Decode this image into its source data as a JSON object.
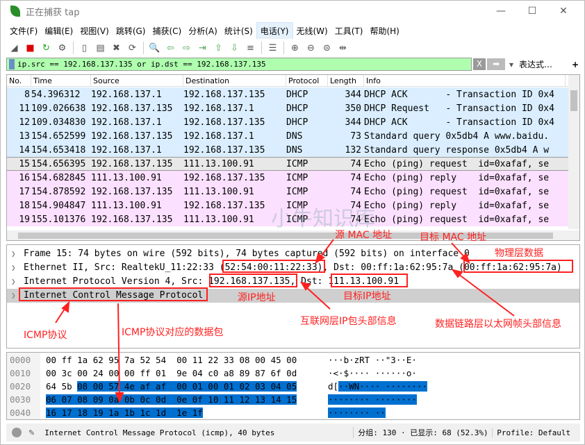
{
  "window": {
    "title": "正在捕获 tap",
    "minimize": "—",
    "maximize": "☐",
    "close": "✕"
  },
  "menu": [
    "文件(F)",
    "编辑(E)",
    "视图(V)",
    "跳转(G)",
    "捕获(C)",
    "分析(A)",
    "统计(S)",
    "电话(Y)",
    "无线(W)",
    "工具(T)",
    "帮助(H)"
  ],
  "toolbar": [
    "shark-fin-icon",
    "stop-icon",
    "restart-icon",
    "options-icon",
    "open-icon",
    "save-icon",
    "close-file-icon",
    "reload-icon",
    "find-icon",
    "back-icon",
    "forward-icon",
    "goto-icon",
    "first-icon",
    "last-icon",
    "autoscroll-icon",
    "colorize-icon",
    "zoom-in-icon",
    "zoom-out-icon",
    "zoom-normal-icon",
    "resize-columns-icon"
  ],
  "filter": {
    "value": "ip.src == 192.168.137.135 or ip.dst == 192.168.137.135",
    "expression": "表达式…",
    "plus": "+",
    "clear": "X",
    "apply": "➡",
    "dropdown": "▾"
  },
  "columns": [
    "No.",
    "Time",
    "Source",
    "Destination",
    "Protocol",
    "Length",
    "Info"
  ],
  "packets": [
    [
      "8",
      "54.396312",
      "192.168.137.1",
      "192.168.137.135",
      "DHCP",
      "344",
      "DHCP ACK       - Transaction ID 0x4",
      "blue"
    ],
    [
      "11",
      "109.026638",
      "192.168.137.135",
      "192.168.137.1",
      "DHCP",
      "350",
      "DHCP Request   - Transaction ID 0x4",
      "blue"
    ],
    [
      "12",
      "109.034830",
      "192.168.137.1",
      "192.168.137.135",
      "DHCP",
      "344",
      "DHCP ACK       - Transaction ID 0x4",
      "blue"
    ],
    [
      "13",
      "154.652599",
      "192.168.137.135",
      "192.168.137.1",
      "DNS",
      "73",
      "Standard query 0x5db4 A www.baidu.",
      "blue"
    ],
    [
      "14",
      "154.653418",
      "192.168.137.1",
      "192.168.137.135",
      "DNS",
      "132",
      "Standard query response 0x5db4 A w",
      "blue"
    ],
    [
      "15",
      "154.656395",
      "192.168.137.135",
      "111.13.100.91",
      "ICMP",
      "74",
      "Echo (ping) request  id=0xafaf, se",
      "sel"
    ],
    [
      "16",
      "154.682845",
      "111.13.100.91",
      "192.168.137.135",
      "ICMP",
      "74",
      "Echo (ping) reply    id=0xafaf, se",
      "pink"
    ],
    [
      "17",
      "154.878592",
      "192.168.137.135",
      "111.13.100.91",
      "ICMP",
      "74",
      "Echo (ping) request  id=0xafaf, se",
      "pink"
    ],
    [
      "18",
      "154.904847",
      "111.13.100.91",
      "192.168.137.135",
      "ICMP",
      "74",
      "Echo (ping) reply    id=0xafaf, se",
      "pink"
    ],
    [
      "19",
      "155.101376",
      "192.168.137.135",
      "111.13.100.91",
      "ICMP",
      "74",
      "Echo (ping) request  id=0xafaf, se",
      "pink"
    ]
  ],
  "details": [
    "Frame 15: 74 bytes on wire (592 bits), 74 bytes captured (592 bits) on interface 0",
    "Ethernet II, Src: RealtekU_11:22:33 (52:54:00:11:22:33), Dst: 00:ff:1a:62:95:7a (00:ff:1a:62:95:7a)",
    "Internet Protocol Version 4, Src: 192.168.137.135, Dst: 111.13.100.91",
    "Internet Control Message Protocol"
  ],
  "hex": [
    {
      "off": "0000",
      "plain": "00 ff 1a 62 95 7a 52 54  00 11 22 33 08 00 45 00",
      "sel": "",
      "ascii": "···b·zRT ··\"3··E·",
      "asel": ""
    },
    {
      "off": "0010",
      "plain": "00 3c 00 24 00 00 ff 01  9e 04 c0 a8 89 87 6f 0d",
      "sel": "",
      "ascii": "·<·$···· ······o·",
      "asel": ""
    },
    {
      "off": "0020",
      "plain": "64 5b ",
      "sel": "08 00 57 4e af af  00 01 00 01 02 03 04 05",
      "ascii": "d[",
      "asel": "··WN···· ········"
    },
    {
      "off": "0030",
      "plain": "",
      "sel": "06 07 08 09 0a 0b 0c 0d  0e 0f 10 11 12 13 14 15",
      "ascii": "",
      "asel": "········ ········"
    },
    {
      "off": "0040",
      "plain": "",
      "sel": "16 17 18 19 1a 1b 1c 1d  1e 1f",
      "ascii": "",
      "asel": "········ ··"
    }
  ],
  "status": {
    "text": "Internet Control Message Protocol (icmp), 40 bytes",
    "packets": "分组: 130 · 已显示: 68 (52.3%)",
    "profile": "Profile: Default"
  },
  "annotations": {
    "src_mac": "源 MAC 地址",
    "dst_mac": "目标 MAC 地址",
    "physical": "物理层数据",
    "src_ip": "源IP地址",
    "dst_ip": "目标IP地址",
    "ip_header": "互联网层IP包头部信息",
    "eth_header": "数据链路层以太网帧头部信息",
    "icmp": "ICMP协议",
    "icmp_data": "ICMP协议对应的数据包",
    "color": "#ff2020"
  },
  "watermark": "小牛知识库"
}
